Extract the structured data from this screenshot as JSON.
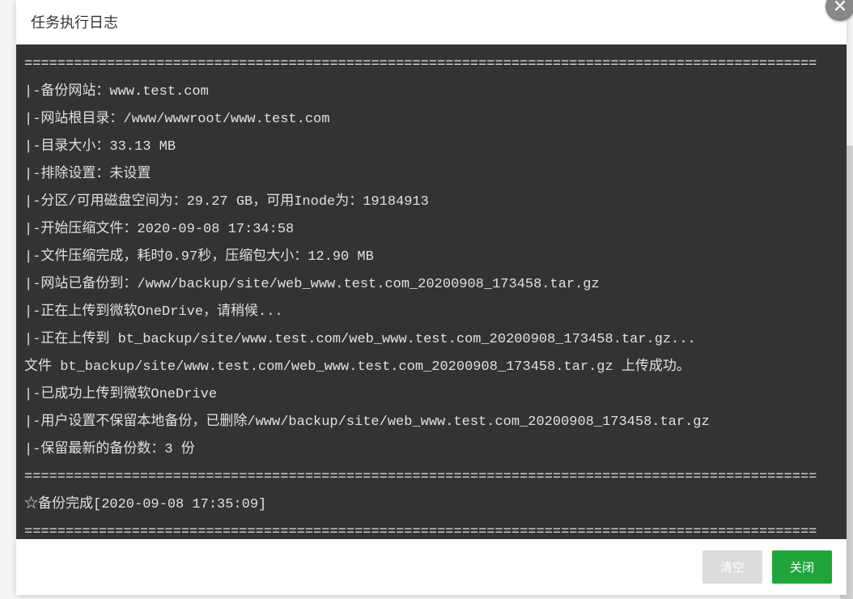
{
  "modal": {
    "title": "任务执行日志",
    "close_icon": "✕"
  },
  "log": {
    "lines": [
      "================================================================================================",
      "|-备份网站：www.test.com",
      "|-网站根目录：/www/wwwroot/www.test.com",
      "|-目录大小：33.13 MB",
      "|-排除设置：未设置",
      "|-分区/可用磁盘空间为：29.27 GB，可用Inode为：19184913",
      "|-开始压缩文件：2020-09-08 17:34:58",
      "|-文件压缩完成，耗时0.97秒，压缩包大小：12.90 MB",
      "|-网站已备份到：/www/backup/site/web_www.test.com_20200908_173458.tar.gz",
      "|-正在上传到微软OneDrive，请稍候...",
      "|-正在上传到 bt_backup/site/www.test.com/web_www.test.com_20200908_173458.tar.gz...",
      "文件 bt_backup/site/www.test.com/web_www.test.com_20200908_173458.tar.gz 上传成功。",
      "|-已成功上传到微软OneDrive",
      "|-用户设置不保留本地备份，已删除/www/backup/site/web_www.test.com_20200908_173458.tar.gz",
      "|-保留最新的备份数：3 份",
      "================================================================================================",
      "☆备份完成[2020-09-08 17:35:09]",
      "================================================================================================"
    ]
  },
  "footer": {
    "clear_label": "清空",
    "close_label": "关闭"
  }
}
